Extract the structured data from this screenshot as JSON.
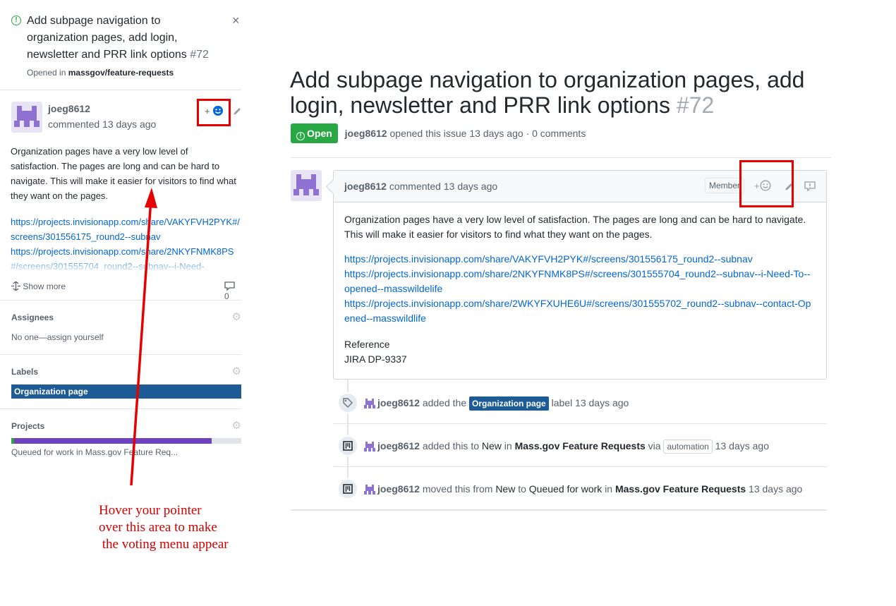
{
  "side_panel": {
    "title": "Add subpage navigation to organization pages, add login, newsletter and PRR link options",
    "number": "#72",
    "opened_prefix": "Opened in",
    "repo": "massgov/feature-requests",
    "close_symbol": "×",
    "author": "joeg8612",
    "when": "commented 13 days ago",
    "react_plus": "+",
    "body": "Organization pages have a very low level of satisfaction. The pages are long and can be hard to navigate. This will make it easier for visitors to find what they want on the pages.",
    "links": [
      "https://projects.invisionapp.com/share/VAKYFVH2PYK#/screens/301556175_round2--subnav",
      "https://projects.invisionapp.com/share/2NKYFNMK8PS#/screens/301555704_round2--subnav--i-Need-"
    ],
    "show_more": "Show more",
    "comment_count": "0",
    "assignees_title": "Assignees",
    "assignees_value": "No one—assign yourself",
    "labels_title": "Labels",
    "label": "Organization page",
    "projects_title": "Projects",
    "project_progress_pct": 87,
    "project_value": "Queued for work in Mass.gov Feature Req..."
  },
  "issue": {
    "title": "Add subpage navigation to organization pages, add login, newsletter and PRR link options",
    "number": "#72",
    "state": "Open",
    "author": "joeg8612",
    "meta": "opened this issue 13 days ago · 0 comments"
  },
  "comment": {
    "author": "joeg8612",
    "when": "commented 13 days ago",
    "role": "Member",
    "react_plus": "+",
    "body": "Organization pages have a very low level of satisfaction. The pages are long and can be hard to navigate. This will make it easier for visitors to find what they want on the pages.",
    "links": [
      "https://projects.invisionapp.com/share/VAKYFVH2PYK#/screens/301556175_round2--subnav",
      "https://projects.invisionapp.com/share/2NKYFNMK8PS#/screens/301555704_round2--subnav--i-Need-To--opened--masswildelife",
      "https://projects.invisionapp.com/share/2WKYFXUHE6U#/screens/301555702_round2--subnav--contact-Opened--masswildlife"
    ],
    "reference_title": "Reference",
    "reference_value": "JIRA DP-9337"
  },
  "events": [
    {
      "author": "joeg8612",
      "pre": "added the",
      "label": "Organization page",
      "post": "label 13 days ago"
    },
    {
      "author": "joeg8612",
      "pre": "added this to",
      "col": "New",
      "mid": "in",
      "project": "Mass.gov Feature Requests",
      "via": "via",
      "actor": "automation",
      "post": "13 days ago"
    },
    {
      "author": "joeg8612",
      "pre": "moved this from",
      "from": "New",
      "to_word": "to",
      "col": "Queued for work",
      "mid": "in",
      "project": "Mass.gov Feature Requests",
      "post": "13 days ago"
    }
  ],
  "annotation": {
    "note": "Hover your pointer\nover this area to make\n the voting menu appear"
  },
  "colors": {
    "open_green": "#28a745",
    "label_blue": "#1d5b96",
    "annotation_red": "#e60000",
    "project_purple": "#6f42c1"
  },
  "icons": [
    "issue-opened-icon",
    "close-icon",
    "smiley-icon",
    "pencil-icon",
    "settings-gear-icon",
    "comment-icon",
    "tag-icon",
    "project-icon",
    "report-icon",
    "unfold-icon"
  ]
}
